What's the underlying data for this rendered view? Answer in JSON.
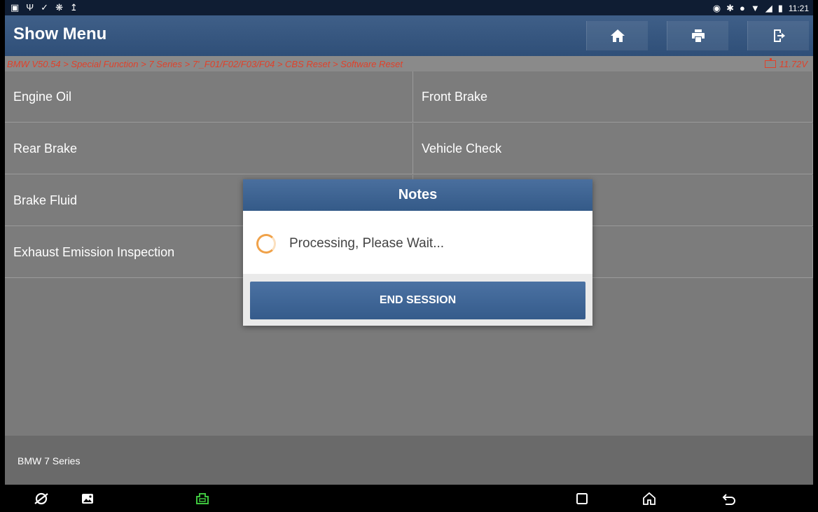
{
  "status_bar": {
    "time": "11:21",
    "left_icons": [
      "image-notification-icon",
      "usb-icon",
      "check-icon",
      "settings-icon",
      "upload-icon"
    ],
    "right_icons": [
      "location-icon",
      "bluetooth-icon",
      "do-not-disturb-icon",
      "wifi-icon",
      "signal-icon",
      "battery-icon"
    ]
  },
  "header": {
    "title": "Show Menu",
    "buttons": [
      "home-icon",
      "print-icon",
      "exit-icon"
    ]
  },
  "breadcrumb": {
    "path": "BMW V50.54 > Special Function > 7 Series > 7'_F01/F02/F03/F04 > CBS Reset > Software Reset",
    "voltage": "11.72V"
  },
  "menu": {
    "items": [
      "Engine Oil",
      "Front Brake",
      "Rear Brake",
      "Vehicle Check",
      "Brake Fluid",
      "Exhaust Emission Inspection"
    ]
  },
  "footer": {
    "model": "BMW 7 Series"
  },
  "dialog": {
    "title": "Notes",
    "message": "Processing, Please Wait...",
    "button": "END SESSION"
  },
  "colors": {
    "accent": "#345a88",
    "breadcrumb_text": "#e0412a",
    "spinner": "#f0a24a",
    "vci_icon": "#3ec43e"
  }
}
